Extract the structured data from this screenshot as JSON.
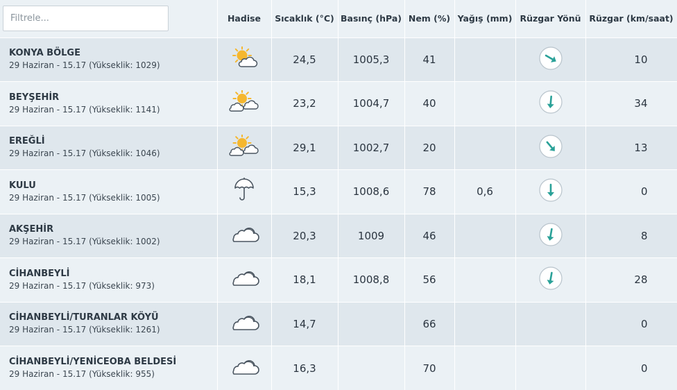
{
  "filter": {
    "placeholder": "Filtrele..."
  },
  "columns": {
    "hadise": "Hadise",
    "temp": "Sıcaklık (°C)",
    "pressure": "Basınç (hPa)",
    "humidity": "Nem (%)",
    "rain": "Yağış (mm)",
    "wind_dir": "Rüzgar Yönü",
    "wind_speed": "Rüzgar (km/saat)"
  },
  "colors": {
    "arrow": "#2aa198",
    "sun": "#f5b72f",
    "icon_stroke": "#4a5560"
  },
  "rows": [
    {
      "name": "KONYA BÖLGE",
      "info": "29 Haziran - 15.17 (Yükseklik: 1029)",
      "icon": "sun-behind-cloud-icon",
      "temp": "24,5",
      "pressure": "1005,3",
      "humidity": "41",
      "rain": "",
      "wind_dir_deg": 120,
      "wind_speed": "10"
    },
    {
      "name": "BEYŞEHİR",
      "info": "29 Haziran - 15.17 (Yükseklik: 1141)",
      "icon": "sun-with-two-clouds-icon",
      "temp": "23,2",
      "pressure": "1004,7",
      "humidity": "40",
      "rain": "",
      "wind_dir_deg": 185,
      "wind_speed": "34"
    },
    {
      "name": "EREĞLİ",
      "info": "29 Haziran - 15.17 (Yükseklik: 1046)",
      "icon": "sun-with-two-clouds-icon",
      "temp": "29,1",
      "pressure": "1002,7",
      "humidity": "20",
      "rain": "",
      "wind_dir_deg": 140,
      "wind_speed": "13"
    },
    {
      "name": "KULU",
      "info": "29 Haziran - 15.17 (Yükseklik: 1005)",
      "icon": "umbrella-icon",
      "temp": "15,3",
      "pressure": "1008,6",
      "humidity": "78",
      "rain": "0,6",
      "wind_dir_deg": 180,
      "wind_speed": "0"
    },
    {
      "name": "AKŞEHİR",
      "info": "29 Haziran - 15.17 (Yükseklik: 1002)",
      "icon": "cloud-icon",
      "temp": "20,3",
      "pressure": "1009",
      "humidity": "46",
      "rain": "",
      "wind_dir_deg": 190,
      "wind_speed": "8"
    },
    {
      "name": "CİHANBEYLİ",
      "info": "29 Haziran - 15.17 (Yükseklik: 973)",
      "icon": "cloud-icon",
      "temp": "18,1",
      "pressure": "1008,8",
      "humidity": "56",
      "rain": "",
      "wind_dir_deg": 190,
      "wind_speed": "28"
    },
    {
      "name": "CİHANBEYLİ/TURANLAR KÖYÜ",
      "info": "29 Haziran - 15.17 (Yükseklik: 1261)",
      "icon": "cloud-icon",
      "temp": "14,7",
      "pressure": "",
      "humidity": "66",
      "rain": "",
      "wind_dir_deg": null,
      "wind_speed": "0"
    },
    {
      "name": "CİHANBEYLİ/YENİCEOBA BELDESİ",
      "info": "29 Haziran - 15.17 (Yükseklik: 955)",
      "icon": "cloud-icon",
      "temp": "16,3",
      "pressure": "",
      "humidity": "70",
      "rain": "",
      "wind_dir_deg": null,
      "wind_speed": "0"
    }
  ]
}
